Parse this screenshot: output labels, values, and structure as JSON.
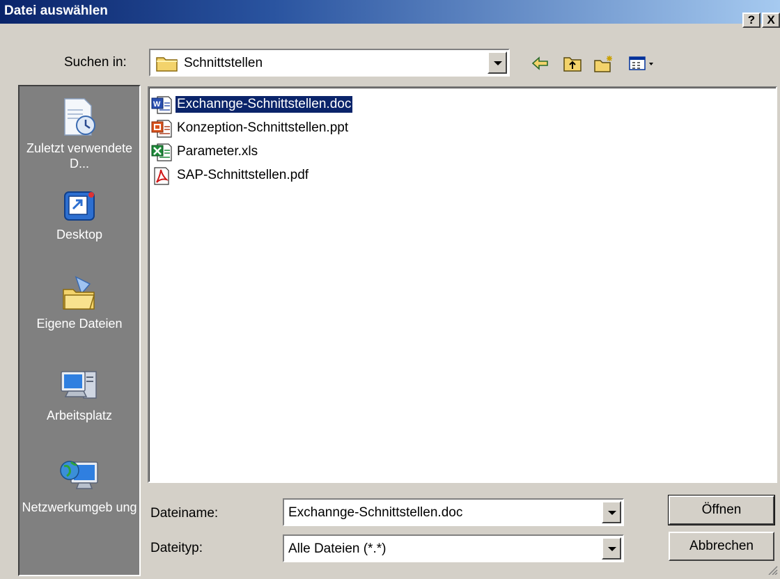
{
  "window": {
    "title": "Datei auswählen",
    "help_button": "?",
    "close_button": "X"
  },
  "lookin": {
    "label": "Suchen in:",
    "value": "Schnittstellen"
  },
  "toolbar": {
    "icons": [
      "back-arrow-icon",
      "up-folder-icon",
      "new-folder-icon",
      "view-menu-icon"
    ]
  },
  "places": [
    {
      "label": "Zuletzt verwendete D...",
      "icon": "recent-documents-icon"
    },
    {
      "label": "Desktop",
      "icon": "desktop-icon"
    },
    {
      "label": "Eigene Dateien",
      "icon": "my-documents-icon"
    },
    {
      "label": "Arbeitsplatz",
      "icon": "my-computer-icon"
    },
    {
      "label": "Netzwerkumgeb ung",
      "icon": "network-icon"
    }
  ],
  "files": [
    {
      "name": "Exchannge-Schnittstellen.doc",
      "icon": "word-file-icon",
      "selected": true
    },
    {
      "name": "Konzeption-Schnittstellen.ppt",
      "icon": "powerpoint-file-icon",
      "selected": false
    },
    {
      "name": "Parameter.xls",
      "icon": "excel-file-icon",
      "selected": false
    },
    {
      "name": "SAP-Schnittstellen.pdf",
      "icon": "pdf-file-icon",
      "selected": false
    }
  ],
  "filename": {
    "label": "Dateiname:",
    "value": "Exchannge-Schnittstellen.doc"
  },
  "filetype": {
    "label": "Dateityp:",
    "value": "Alle Dateien (*.*)"
  },
  "buttons": {
    "open": "Öffnen",
    "cancel": "Abbrechen"
  },
  "colors": {
    "title_start": "#0a246a",
    "title_end": "#a6caf0",
    "face": "#d4d0c8",
    "places_bg": "#808080",
    "selection": "#0a246a"
  }
}
